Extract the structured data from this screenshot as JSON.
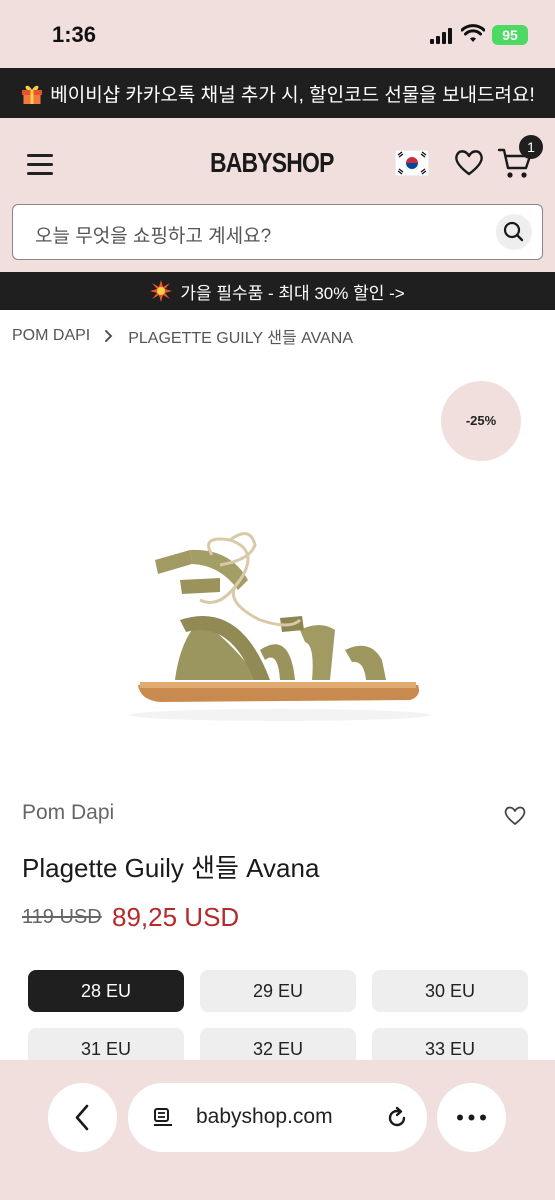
{
  "status_bar": {
    "time": "1:36",
    "battery": "95"
  },
  "promo_bar": {
    "icon": "gift-icon",
    "text": "베이비샵 카카오톡 채널 추가 시, 할인코드 선물을 보내드려요!"
  },
  "header": {
    "logo_text": "BABYSHOP",
    "cart_count": "1"
  },
  "search": {
    "placeholder": "오늘 무엇을 쇼핑하고 계세요?"
  },
  "sale_bar": {
    "icon": "burst-icon",
    "text": "가을 필수품 - 최대 30% 할인 ->"
  },
  "breadcrumb": {
    "items": [
      "POM DAPI",
      "PLAGETTE GUILY 샌들 AVANA"
    ]
  },
  "product": {
    "discount": "-25%",
    "brand": "Pom Dapi",
    "title": "Plagette Guily 샌들 Avana",
    "old_price": "119 USD",
    "price": "89,25 USD"
  },
  "sizes": [
    {
      "label": "28 EU",
      "selected": true
    },
    {
      "label": "29 EU",
      "selected": false
    },
    {
      "label": "30 EU",
      "selected": false
    },
    {
      "label": "31 EU",
      "selected": false
    },
    {
      "label": "32 EU",
      "selected": false
    },
    {
      "label": "33 EU",
      "selected": false
    }
  ],
  "browser": {
    "url": "babyshop.com"
  },
  "colors": {
    "header_bg": "#f1dfdd",
    "dark": "#1f1f1f",
    "price_red": "#b52a2a"
  }
}
